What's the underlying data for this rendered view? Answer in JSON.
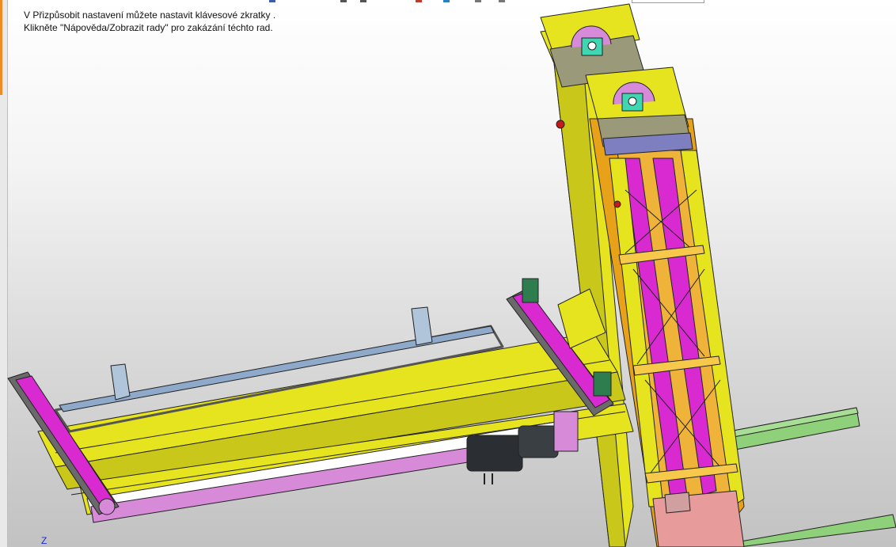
{
  "hint": {
    "line1": "V Přizpůsobit nastavení můžete nastavit klávesové zkratky .",
    "line2": "Klikněte \"Nápověda/Zobrazit rady\" pro zakázání téchto rad."
  },
  "axis_label": "Z",
  "colors": {
    "frame_yellow": "#e6e31f",
    "frame_orange": "#e8a21a",
    "magenta": "#d92ad2",
    "pink": "#d78ad8",
    "rail_green": "#8fd07a",
    "steel_blue": "#8ea9c9",
    "motor_dark": "#2b2f33"
  }
}
